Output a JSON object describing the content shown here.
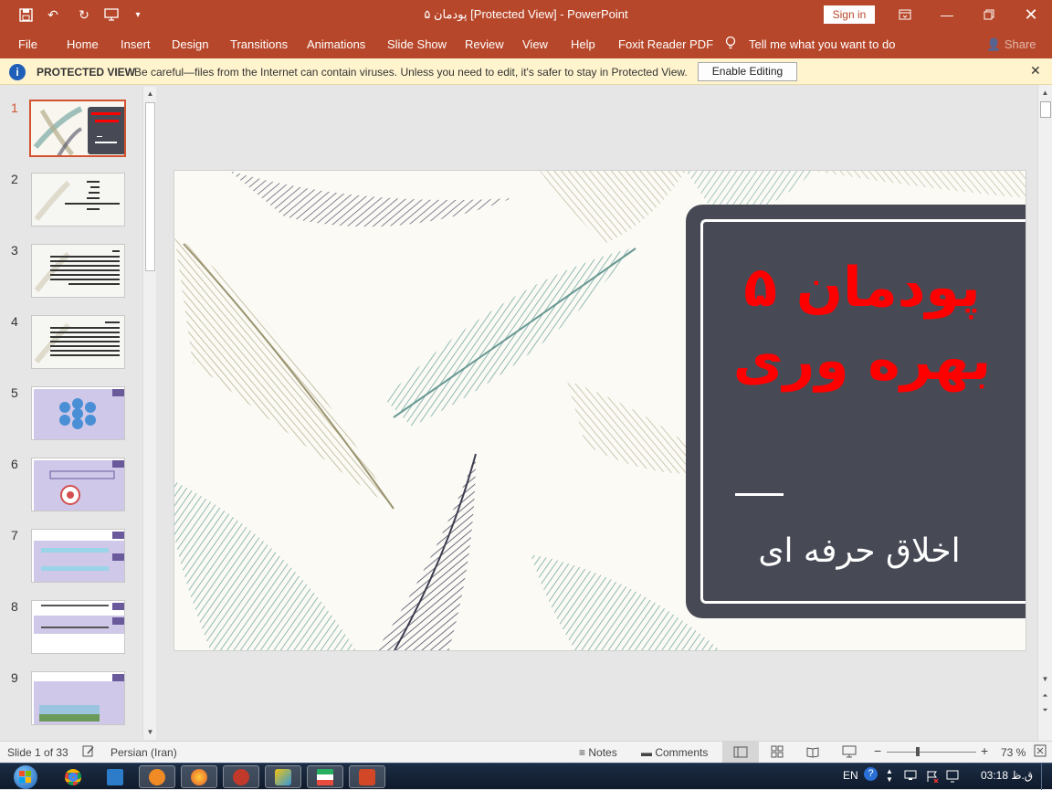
{
  "titlebar": {
    "title": "پودمان ۵ [Protected View]  -  PowerPoint",
    "signin_label": "Sign in",
    "quick_access": [
      "save-icon",
      "undo-icon",
      "redo-icon",
      "present-icon",
      "customize-icon"
    ]
  },
  "ribbon": {
    "tabs": [
      "File",
      "Home",
      "Insert",
      "Design",
      "Transitions",
      "Animations",
      "Slide Show",
      "Review",
      "View",
      "Help",
      "Foxit Reader PDF"
    ],
    "tell_me": "Tell me what you want to do",
    "share": "Share"
  },
  "protected_view": {
    "label": "PROTECTED VIEW",
    "message": "Be careful—files from the Internet can contain viruses. Unless you need to edit, it's safer to stay in Protected View.",
    "enable_label": "Enable Editing"
  },
  "thumbnails": {
    "numbers": [
      "1",
      "2",
      "3",
      "4",
      "5",
      "6",
      "7",
      "8",
      "9"
    ],
    "selected": 1
  },
  "slide": {
    "title_line1": "پودمان ۵",
    "title_line2": "بهره وری",
    "subtitle": "اخلاق حرفه ای",
    "colors": {
      "box": "#474a55",
      "title": "#ff0000",
      "teal": "#79a9a4",
      "khaki": "#b3ad8c",
      "slate": "#4d4d62"
    }
  },
  "status": {
    "slide_info": "Slide 1 of 33",
    "language": "Persian (Iran)",
    "notes": "Notes",
    "comments": "Comments",
    "zoom": "73 %"
  },
  "taskbar": {
    "lang": "EN",
    "time": "03:18 ق.ظ"
  }
}
